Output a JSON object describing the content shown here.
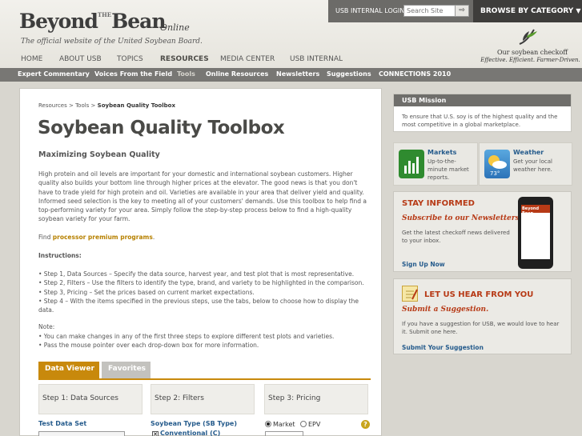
{
  "header": {
    "logo_main": "Beyond",
    "logo_the": "THE",
    "logo_bean": "Bean",
    "logo_online": "Online",
    "tagline": "The official website of the United Soybean Board.",
    "login_label": "USB INTERNAL LOGIN",
    "search_placeholder": "Search Site",
    "search_go": "⇨",
    "browse_label": "BROWSE BY CATEGORY",
    "browse_chevron": "▼",
    "checkoff_title": "Our soybean checkoff",
    "checkoff_sub": "Effective. Efficient. Farmer-Driven."
  },
  "main_nav": [
    "HOME",
    "ABOUT USB",
    "TOPICS",
    "RESOURCES",
    "MEDIA CENTER",
    "USB INTERNAL"
  ],
  "main_nav_active": "RESOURCES",
  "sub_nav": [
    "Expert Commentary",
    "Voices From the Field",
    "Tools",
    "Online Resources",
    "Newsletters",
    "Suggestions",
    "CONNECTIONS 2010"
  ],
  "sub_nav_active": "Tools",
  "breadcrumb": {
    "parent1": "Resources",
    "sep": " > ",
    "parent2": "Tools",
    "current": "Soybean Quality Toolbox"
  },
  "page_title": "Soybean Quality Toolbox",
  "subtitle": "Maximizing Soybean Quality",
  "intro": "High protein and oil levels are important for your domestic and international soybean customers. Higher quality also builds your bottom line through higher prices at the elevator. The good news is that you don't have to trade yield for high protein and oil. Varieties are available in your area that deliver yield and quality. Informed seed selection is the key to meeting all of your customers' demands. Use this toolbox to help find a top-performing variety for your area. Simply follow the step-by-step process below to find a high-quality soybean variety for your farm.",
  "find_prefix": "Find ",
  "find_link": "processor premium programs",
  "find_suffix": ".",
  "instructions_head": "Instructions:",
  "instructions": [
    "• Step 1, Data Sources – Specify the data source, harvest year, and test plot that is most representative.",
    "• Step 2, Filters – Use the filters to identify the type, brand, and variety to be highlighted in the comparison.",
    "• Step 3, Pricing – Set the prices based on current market expectations.",
    "• Step 4 – With the items specified in the previous steps, use the tabs, below to choose how to display the data."
  ],
  "note_head": "Note:",
  "notes": [
    "• You can make changes in any of the first three steps to explore different test plots and varieties.",
    "• Pass the mouse pointer over each drop-down box for more information."
  ],
  "tabs": {
    "viewer": "Data Viewer",
    "favorites": "Favorites"
  },
  "steps": [
    "Step 1: Data Sources",
    "Step 2: Filters",
    "Step 3: Pricing"
  ],
  "fields": {
    "test_data_set": "Test Data Set",
    "soybean_type": "Soybean Type (SB Type)",
    "market": "Market",
    "epv": "EPV",
    "help": "?",
    "conventional": "Conventional (C)",
    "checkbox_mark": "✕"
  },
  "sidebar": {
    "mission_head": "USB Mission",
    "mission_text": "To ensure that U.S. soy is of the highest quality and the most competitive in a global marketplace.",
    "market_title": "Markets",
    "market_text": "Up-to-the-minute market reports.",
    "weather_title": "Weather",
    "weather_text": "Get your local weather here.",
    "weather_temp": "73°",
    "stay_head": "STAY INFORMED",
    "stay_sub": "Subscribe to our Newsletters.",
    "stay_text": "Get the latest checkoff news delivered to your inbox.",
    "stay_link": "Sign Up Now",
    "phone_brand": "Beyond Bean",
    "hear_head": "LET US HEAR FROM YOU",
    "hear_sub": "Submit a Suggestion.",
    "hear_text": "If you have a suggestion for USB, we would love to hear it. Submit one here.",
    "hear_link": "Submit Your Suggestion"
  },
  "colors": {
    "accent": "#c8890c",
    "link": "#255b8c",
    "alert": "#b73a16",
    "nav_bar": "#787774"
  }
}
